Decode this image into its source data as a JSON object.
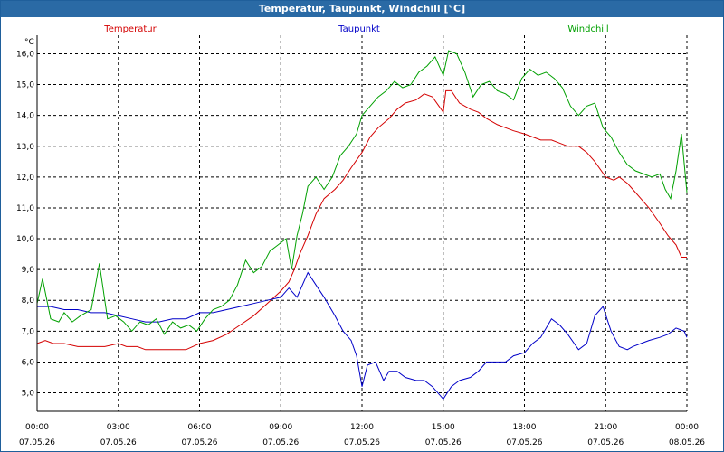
{
  "window": {
    "title": "Temperatur, Taupunkt, Windchill [°C]"
  },
  "colors": {
    "titlebar": "#2a6aa5",
    "grid": "#000000"
  },
  "chart_data": {
    "type": "line",
    "title": "Temperatur, Taupunkt, Windchill [°C]",
    "ylabel": "°C",
    "xlabel": "",
    "ylim": [
      4.4,
      16.6
    ],
    "xlim": [
      0,
      24
    ],
    "grid": true,
    "legend": "top",
    "y_ticks": [
      5.0,
      6.0,
      7.0,
      8.0,
      9.0,
      10.0,
      11.0,
      12.0,
      13.0,
      14.0,
      15.0,
      16.0
    ],
    "y_tick_labels": [
      "5,0",
      "6,0",
      "7,0",
      "8,0",
      "9,0",
      "10,0",
      "11,0",
      "12,0",
      "13,0",
      "14,0",
      "15,0",
      "16,0"
    ],
    "x_ticks": [
      0,
      3,
      6,
      9,
      12,
      15,
      18,
      21,
      24
    ],
    "x_tick_labels": [
      [
        "00:00",
        "07.05.26"
      ],
      [
        "03:00",
        "07.05.26"
      ],
      [
        "06:00",
        "07.05.26"
      ],
      [
        "09:00",
        "07.05.26"
      ],
      [
        "12:00",
        "07.05.26"
      ],
      [
        "15:00",
        "07.05.26"
      ],
      [
        "18:00",
        "07.05.26"
      ],
      [
        "21:00",
        "07.05.26"
      ],
      [
        "00:00",
        "08.05.26"
      ]
    ],
    "series": [
      {
        "name": "Temperatur",
        "color": "#d40000",
        "points": [
          [
            0.0,
            6.6
          ],
          [
            0.3,
            6.7
          ],
          [
            0.6,
            6.6
          ],
          [
            1.0,
            6.6
          ],
          [
            1.5,
            6.5
          ],
          [
            2.0,
            6.5
          ],
          [
            2.5,
            6.5
          ],
          [
            3.0,
            6.6
          ],
          [
            3.3,
            6.5
          ],
          [
            3.7,
            6.5
          ],
          [
            4.0,
            6.4
          ],
          [
            4.5,
            6.4
          ],
          [
            5.0,
            6.4
          ],
          [
            5.5,
            6.4
          ],
          [
            6.0,
            6.6
          ],
          [
            6.5,
            6.7
          ],
          [
            7.0,
            6.9
          ],
          [
            7.5,
            7.2
          ],
          [
            8.0,
            7.5
          ],
          [
            8.5,
            7.9
          ],
          [
            9.0,
            8.3
          ],
          [
            9.3,
            8.6
          ],
          [
            9.5,
            9.0
          ],
          [
            9.7,
            9.5
          ],
          [
            10.0,
            10.1
          ],
          [
            10.3,
            10.8
          ],
          [
            10.6,
            11.3
          ],
          [
            11.0,
            11.6
          ],
          [
            11.3,
            11.9
          ],
          [
            11.6,
            12.3
          ],
          [
            12.0,
            12.8
          ],
          [
            12.3,
            13.3
          ],
          [
            12.6,
            13.6
          ],
          [
            13.0,
            13.9
          ],
          [
            13.3,
            14.2
          ],
          [
            13.6,
            14.4
          ],
          [
            14.0,
            14.5
          ],
          [
            14.3,
            14.7
          ],
          [
            14.6,
            14.6
          ],
          [
            15.0,
            14.1
          ],
          [
            15.1,
            14.8
          ],
          [
            15.3,
            14.8
          ],
          [
            15.6,
            14.4
          ],
          [
            16.0,
            14.2
          ],
          [
            16.3,
            14.1
          ],
          [
            16.6,
            13.9
          ],
          [
            17.0,
            13.7
          ],
          [
            17.3,
            13.6
          ],
          [
            17.6,
            13.5
          ],
          [
            18.0,
            13.4
          ],
          [
            18.3,
            13.3
          ],
          [
            18.6,
            13.2
          ],
          [
            19.0,
            13.2
          ],
          [
            19.3,
            13.1
          ],
          [
            19.6,
            13.0
          ],
          [
            20.0,
            13.0
          ],
          [
            20.3,
            12.8
          ],
          [
            20.6,
            12.5
          ],
          [
            21.0,
            12.0
          ],
          [
            21.3,
            11.9
          ],
          [
            21.5,
            12.0
          ],
          [
            21.8,
            11.8
          ],
          [
            22.0,
            11.6
          ],
          [
            22.3,
            11.3
          ],
          [
            22.6,
            11.0
          ],
          [
            23.0,
            10.5
          ],
          [
            23.3,
            10.1
          ],
          [
            23.6,
            9.8
          ],
          [
            23.8,
            9.4
          ],
          [
            24.0,
            9.4
          ]
        ]
      },
      {
        "name": "Taupunkt",
        "color": "#0000c8",
        "points": [
          [
            0.0,
            7.8
          ],
          [
            0.5,
            7.8
          ],
          [
            1.0,
            7.7
          ],
          [
            1.5,
            7.7
          ],
          [
            2.0,
            7.6
          ],
          [
            2.5,
            7.6
          ],
          [
            3.0,
            7.5
          ],
          [
            3.5,
            7.4
          ],
          [
            4.0,
            7.3
          ],
          [
            4.5,
            7.3
          ],
          [
            5.0,
            7.4
          ],
          [
            5.5,
            7.4
          ],
          [
            6.0,
            7.6
          ],
          [
            6.5,
            7.6
          ],
          [
            7.0,
            7.7
          ],
          [
            7.5,
            7.8
          ],
          [
            8.0,
            7.9
          ],
          [
            8.5,
            8.0
          ],
          [
            9.0,
            8.1
          ],
          [
            9.3,
            8.4
          ],
          [
            9.6,
            8.1
          ],
          [
            10.0,
            8.9
          ],
          [
            10.3,
            8.5
          ],
          [
            10.6,
            8.1
          ],
          [
            11.0,
            7.5
          ],
          [
            11.3,
            7.0
          ],
          [
            11.6,
            6.7
          ],
          [
            11.8,
            6.2
          ],
          [
            12.0,
            5.2
          ],
          [
            12.2,
            5.9
          ],
          [
            12.5,
            6.0
          ],
          [
            12.8,
            5.4
          ],
          [
            13.0,
            5.7
          ],
          [
            13.3,
            5.7
          ],
          [
            13.6,
            5.5
          ],
          [
            14.0,
            5.4
          ],
          [
            14.3,
            5.4
          ],
          [
            14.6,
            5.2
          ],
          [
            15.0,
            4.8
          ],
          [
            15.3,
            5.2
          ],
          [
            15.6,
            5.4
          ],
          [
            16.0,
            5.5
          ],
          [
            16.3,
            5.7
          ],
          [
            16.6,
            6.0
          ],
          [
            17.0,
            6.0
          ],
          [
            17.3,
            6.0
          ],
          [
            17.6,
            6.2
          ],
          [
            18.0,
            6.3
          ],
          [
            18.3,
            6.6
          ],
          [
            18.6,
            6.8
          ],
          [
            19.0,
            7.4
          ],
          [
            19.3,
            7.2
          ],
          [
            19.6,
            6.9
          ],
          [
            20.0,
            6.4
          ],
          [
            20.3,
            6.6
          ],
          [
            20.6,
            7.5
          ],
          [
            20.9,
            7.8
          ],
          [
            21.2,
            7.0
          ],
          [
            21.5,
            6.5
          ],
          [
            21.8,
            6.4
          ],
          [
            22.0,
            6.5
          ],
          [
            22.3,
            6.6
          ],
          [
            22.6,
            6.7
          ],
          [
            23.0,
            6.8
          ],
          [
            23.3,
            6.9
          ],
          [
            23.6,
            7.1
          ],
          [
            23.9,
            7.0
          ],
          [
            24.0,
            6.8
          ]
        ]
      },
      {
        "name": "Windchill",
        "color": "#00a000",
        "points": [
          [
            0.0,
            7.9
          ],
          [
            0.2,
            8.7
          ],
          [
            0.5,
            7.4
          ],
          [
            0.8,
            7.3
          ],
          [
            1.0,
            7.6
          ],
          [
            1.3,
            7.3
          ],
          [
            1.6,
            7.5
          ],
          [
            2.0,
            7.7
          ],
          [
            2.3,
            9.2
          ],
          [
            2.6,
            7.4
          ],
          [
            2.9,
            7.5
          ],
          [
            3.2,
            7.3
          ],
          [
            3.5,
            7.0
          ],
          [
            3.8,
            7.3
          ],
          [
            4.1,
            7.2
          ],
          [
            4.4,
            7.4
          ],
          [
            4.7,
            6.9
          ],
          [
            5.0,
            7.3
          ],
          [
            5.3,
            7.1
          ],
          [
            5.6,
            7.2
          ],
          [
            5.9,
            7.0
          ],
          [
            6.2,
            7.4
          ],
          [
            6.5,
            7.7
          ],
          [
            6.8,
            7.8
          ],
          [
            7.1,
            8.0
          ],
          [
            7.4,
            8.5
          ],
          [
            7.7,
            9.3
          ],
          [
            8.0,
            8.9
          ],
          [
            8.3,
            9.1
          ],
          [
            8.6,
            9.6
          ],
          [
            8.9,
            9.8
          ],
          [
            9.2,
            10.0
          ],
          [
            9.4,
            9.0
          ],
          [
            9.6,
            10.1
          ],
          [
            9.8,
            10.8
          ],
          [
            10.0,
            11.7
          ],
          [
            10.3,
            12.0
          ],
          [
            10.6,
            11.6
          ],
          [
            10.9,
            12.0
          ],
          [
            11.2,
            12.7
          ],
          [
            11.5,
            13.0
          ],
          [
            11.8,
            13.4
          ],
          [
            12.0,
            14.0
          ],
          [
            12.3,
            14.3
          ],
          [
            12.6,
            14.6
          ],
          [
            12.9,
            14.8
          ],
          [
            13.2,
            15.1
          ],
          [
            13.5,
            14.9
          ],
          [
            13.8,
            15.0
          ],
          [
            14.1,
            15.4
          ],
          [
            14.4,
            15.6
          ],
          [
            14.7,
            15.9
          ],
          [
            15.0,
            15.3
          ],
          [
            15.2,
            16.1
          ],
          [
            15.5,
            16.0
          ],
          [
            15.8,
            15.4
          ],
          [
            16.1,
            14.6
          ],
          [
            16.4,
            15.0
          ],
          [
            16.7,
            15.1
          ],
          [
            17.0,
            14.8
          ],
          [
            17.3,
            14.7
          ],
          [
            17.6,
            14.5
          ],
          [
            17.9,
            15.2
          ],
          [
            18.2,
            15.5
          ],
          [
            18.5,
            15.3
          ],
          [
            18.8,
            15.4
          ],
          [
            19.1,
            15.2
          ],
          [
            19.4,
            14.9
          ],
          [
            19.7,
            14.3
          ],
          [
            20.0,
            14.0
          ],
          [
            20.3,
            14.3
          ],
          [
            20.6,
            14.4
          ],
          [
            20.9,
            13.6
          ],
          [
            21.2,
            13.3
          ],
          [
            21.5,
            12.8
          ],
          [
            21.8,
            12.4
          ],
          [
            22.1,
            12.2
          ],
          [
            22.4,
            12.1
          ],
          [
            22.7,
            12.0
          ],
          [
            23.0,
            12.1
          ],
          [
            23.2,
            11.6
          ],
          [
            23.4,
            11.3
          ],
          [
            23.6,
            12.2
          ],
          [
            23.8,
            13.4
          ],
          [
            24.0,
            11.5
          ]
        ]
      }
    ]
  }
}
